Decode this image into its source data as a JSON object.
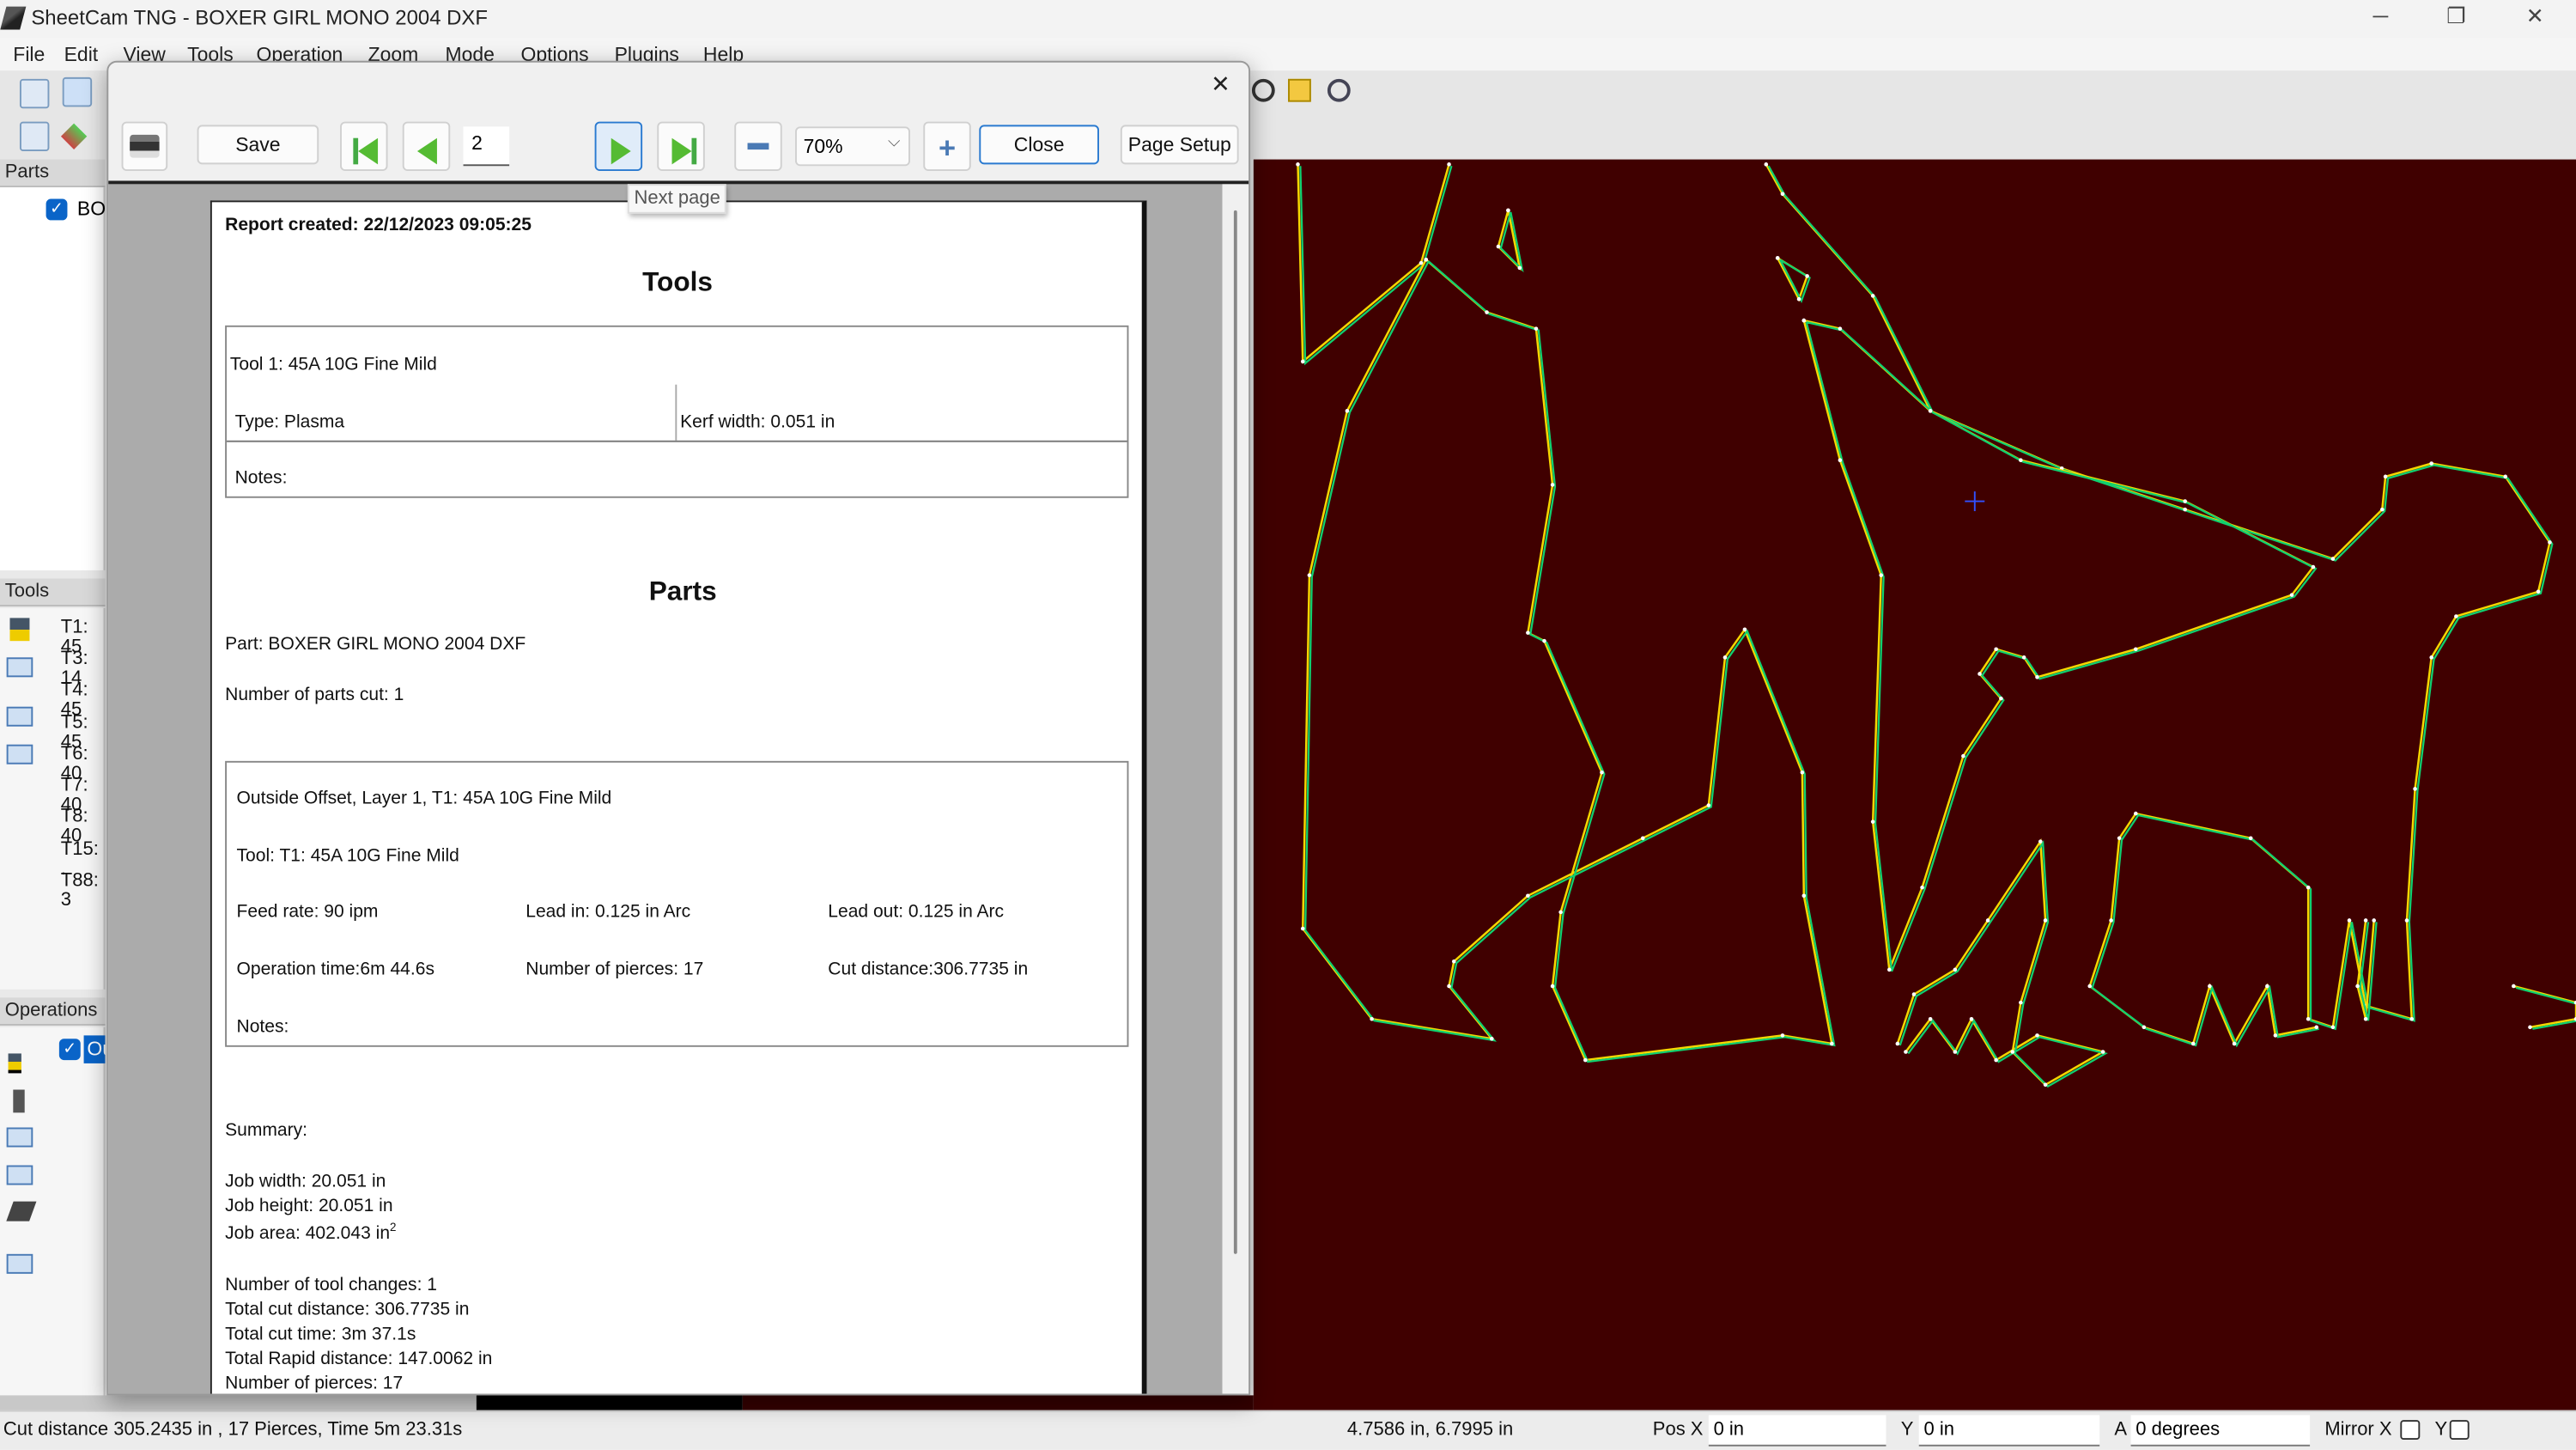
{
  "window": {
    "title": "SheetCam TNG - BOXER GIRL MONO 2004 DXF",
    "controls": [
      "minimize",
      "restore",
      "close"
    ]
  },
  "menu": [
    "File",
    "Edit",
    "View",
    "Tools",
    "Operation",
    "Zoom",
    "Mode",
    "Options",
    "Plugins",
    "Help"
  ],
  "panels": {
    "parts": {
      "header": "Parts",
      "items": [
        {
          "label": "BO",
          "checked": true
        }
      ]
    },
    "tools": {
      "header": "Tools",
      "items": [
        "T1: 45",
        "T3: 14",
        "T4: 45",
        "T5: 45",
        "T6: 40",
        "T7: 40",
        "T8: 40",
        "T15: .",
        "T88: 3"
      ]
    },
    "operations": {
      "header": "Operations",
      "items": [
        {
          "label": "Ou",
          "checked": true,
          "selected": true
        }
      ]
    }
  },
  "dialog": {
    "toolbar": {
      "print_icon": "printer-icon",
      "save": "Save",
      "page_number": "2",
      "zoom_value": "70%",
      "close": "Close",
      "page_setup": "Page Setup",
      "tooltip": "Next page"
    },
    "report": {
      "created": "Report created: 22/12/2023 09:05:25",
      "tools_heading": "Tools",
      "tool_name": "Tool 1: 45A 10G Fine Mild",
      "tool_type": "Type: Plasma",
      "kerf": "Kerf width: 0.051 in",
      "tool_notes": "Notes:",
      "parts_heading": "Parts",
      "part": "Part: BOXER GIRL MONO 2004 DXF",
      "parts_cut": "Number of parts cut: 1",
      "op_title": "Outside Offset, Layer 1, T1: 45A 10G Fine Mild",
      "op_tool": "Tool: T1: 45A 10G Fine Mild",
      "feed": "Feed rate: 90 ipm",
      "lead_in": "Lead in: 0.125 in Arc",
      "lead_out": "Lead out: 0.125 in Arc",
      "op_time": "Operation time:6m 44.6s",
      "pierces": "Number of pierces: 17",
      "cut_dist": "Cut distance:306.7735 in",
      "op_notes": "Notes:",
      "summary": "Summary:",
      "job_width": "Job width: 20.051 in",
      "job_height": "Job height: 20.051 in",
      "job_area": "Job area: 402.043 in",
      "job_area_sup": "2",
      "tool_changes": "Number of tool changes: 1",
      "total_cut": "Total cut distance: 306.7735 in",
      "total_time": "Total cut time: 3m 37.1s",
      "total_rapid": "Total Rapid distance: 147.0062 in",
      "total_pierces": "Number of pierces: 17"
    }
  },
  "status": {
    "summary": "Cut distance 305.2435 in , 17 Pierces, Time 5m 23.31s",
    "coords": "4.7586 in, 6.7995 in",
    "pos_x_label": "Pos X",
    "pos_x": "0 in",
    "y_label": "Y",
    "y": "0 in",
    "a_label": "A",
    "a": "0 degrees",
    "mirror_x_label": "Mirror X",
    "mirror_y_label": "Y"
  },
  "colors": {
    "canvas_bg": "#400000",
    "path": "#f5d800",
    "offset": "#10d070",
    "accent": "#0a64c8"
  }
}
